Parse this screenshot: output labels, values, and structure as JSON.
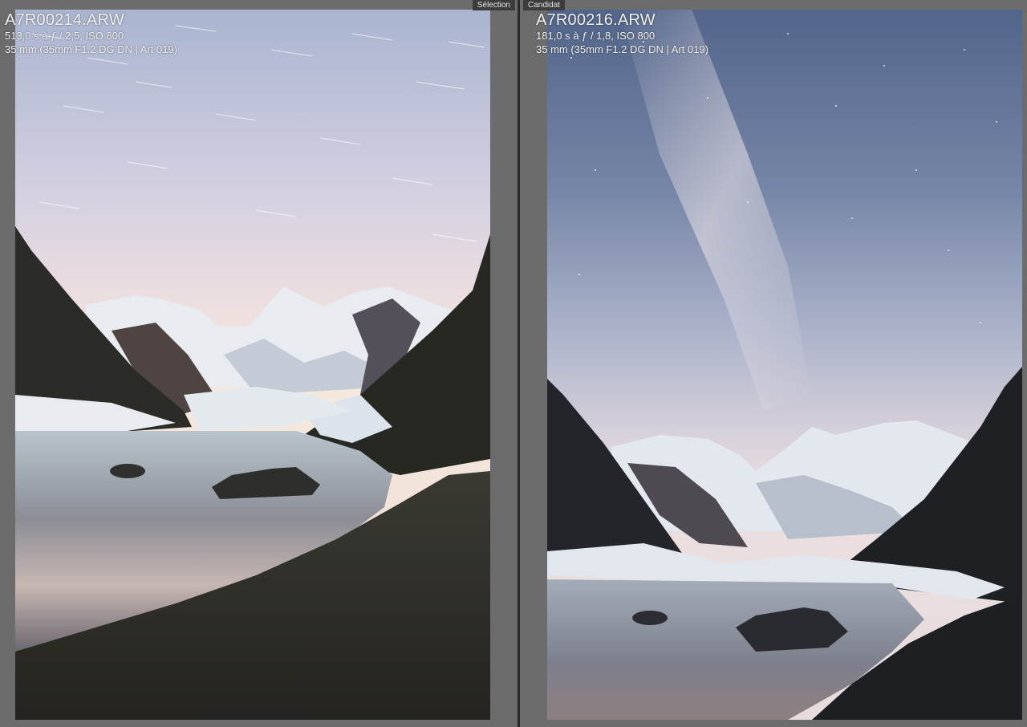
{
  "panes": {
    "left": {
      "tab_label": "Sélection",
      "filename": "A7R00214.ARW",
      "exposure": "513,0 s à ƒ / 2,5, ISO 800",
      "lens": "35 mm (35mm F1.2 DG DN | Art 019)"
    },
    "right": {
      "tab_label": "Candidat",
      "filename": "A7R00216.ARW",
      "exposure": "181,0 s à ƒ / 1,8, ISO 800",
      "lens": "35 mm (35mm F1.2 DG DN | Art 019)"
    }
  },
  "colors": {
    "background": "#6c6c6c",
    "tab_background": "#3c3c3c",
    "divider": "#2a2a2a"
  }
}
